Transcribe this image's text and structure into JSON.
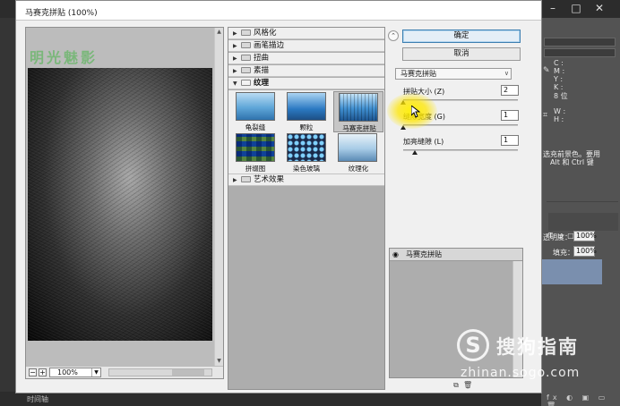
{
  "dialog": {
    "title": "马赛克拼贴 (100%)",
    "ok_label": "确定",
    "cancel_label": "取消",
    "zoom": "100%"
  },
  "preview": {
    "watermark": "明光魅影"
  },
  "filters": {
    "categories": [
      {
        "label": "风格化",
        "expanded": false
      },
      {
        "label": "画笔描边",
        "expanded": false
      },
      {
        "label": "扭曲",
        "expanded": false
      },
      {
        "label": "素描",
        "expanded": false
      },
      {
        "label": "纹理",
        "expanded": true
      },
      {
        "label": "艺术效果",
        "expanded": false
      }
    ],
    "texture_items": [
      "龟裂缝",
      "颗粒",
      "马赛克拼贴",
      "拼缀图",
      "染色玻璃",
      "纹理化"
    ],
    "selected": "马赛克拼贴"
  },
  "settings": {
    "filter_select": "马赛克拼贴",
    "params": [
      {
        "label": "拼贴大小 (Z)",
        "value": "2",
        "fraction": 0.0
      },
      {
        "label": "缝隙宽度 (G)",
        "value": "1",
        "fraction": 0.0
      },
      {
        "label": "加亮缝隙 (L)",
        "value": "1",
        "fraction": 0.1
      }
    ]
  },
  "effect_layers": {
    "items": [
      "马赛克拼贴"
    ]
  },
  "photoshop": {
    "info_labels": [
      "C :",
      "M :",
      "Y :",
      "K :",
      "8 位",
      "W :",
      "H :"
    ],
    "hint_text": [
      "选充前景色。要用",
      "Alt 和 Ctrl 键"
    ],
    "opacity_label": "透明度：",
    "opacity_value": "100%",
    "fill_label": "填充：",
    "fill_value": "100%",
    "timeline_label": "时间轴"
  },
  "watermark": {
    "logo_glyph": "S",
    "name": "搜狗指南",
    "url": "zhinan.sogo.com"
  },
  "colors": {
    "primary_button_border": "#3c7fb1",
    "cursor_highlight": "#ffeb00",
    "selected_layer": "#7a8fae"
  }
}
